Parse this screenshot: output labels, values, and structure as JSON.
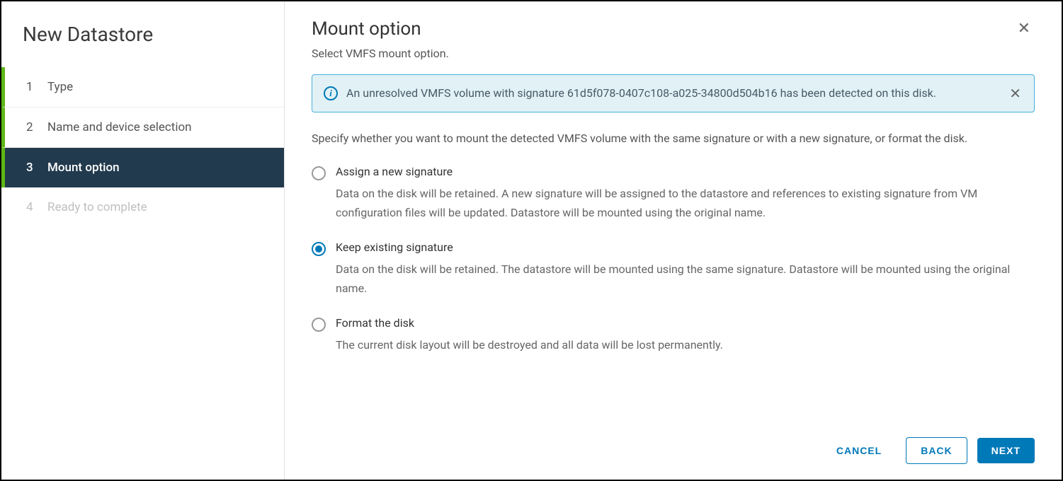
{
  "wizard": {
    "title": "New Datastore",
    "steps": [
      {
        "num": "1",
        "label": "Type",
        "state": "completed"
      },
      {
        "num": "2",
        "label": "Name and device selection",
        "state": "completed"
      },
      {
        "num": "3",
        "label": "Mount option",
        "state": "active"
      },
      {
        "num": "4",
        "label": "Ready to complete",
        "state": "disabled"
      }
    ]
  },
  "panel": {
    "title": "Mount option",
    "subtitle": "Select VMFS mount option.",
    "alert": "An unresolved VMFS volume with signature 61d5f078-0407c108-a025-34800d504b16 has been detected on this disk.",
    "description": "Specify whether you want to mount the detected VMFS volume with the same signature or with a new signature, or format the disk.",
    "options": [
      {
        "label": "Assign a new signature",
        "desc": "Data on the disk will be retained. A new signature will be assigned to the datastore and references to existing signature from VM configuration files will be updated. Datastore will be mounted using the original name.",
        "selected": false
      },
      {
        "label": "Keep existing signature",
        "desc": "Data on the disk will be retained. The datastore will be mounted using the same signature. Datastore will be mounted using the original name.",
        "selected": true
      },
      {
        "label": "Format the disk",
        "desc": "The current disk layout will be destroyed and all data will be lost permanently.",
        "selected": false
      }
    ]
  },
  "buttons": {
    "cancel": "CANCEL",
    "back": "BACK",
    "next": "NEXT"
  },
  "icons": {
    "info_glyph": "i",
    "close_glyph": "✕"
  }
}
